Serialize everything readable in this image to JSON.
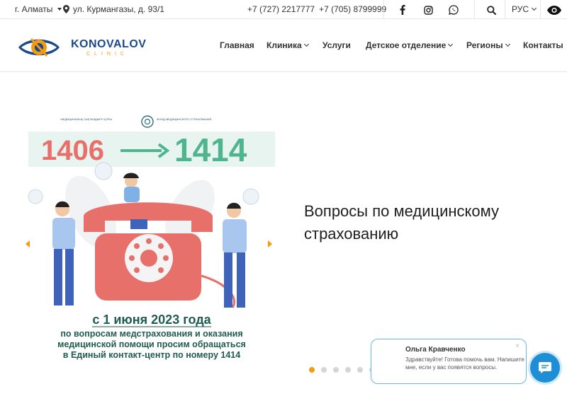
{
  "topbar": {
    "city": "г. Алматы",
    "address": "ул. Курмангазы, д. 93/1",
    "phone1": "+7 (727) 2217777",
    "phone2": "+7 (705) 8799999",
    "lang": "РУС"
  },
  "logo": {
    "name": "KONOVALOV",
    "sub": "CLINIC"
  },
  "nav": {
    "items": [
      {
        "label": "Главная"
      },
      {
        "label": "Клиника"
      },
      {
        "label": "Услуги"
      },
      {
        "label": "Детское отделение"
      },
      {
        "label": "Регионы"
      },
      {
        "label": "Контакты"
      }
    ]
  },
  "slide": {
    "title": "Вопросы по медицинскому страхованию",
    "poster": {
      "old_number": "1406",
      "new_number": "1414",
      "org_left": "МЕДИЦИНАЛЫҚ САҚТАНДЫРУ ҚОРЫ",
      "org_right": "ФОНД МЕДИЦИНСКОГО СТРАХОВАНИЯ",
      "date": "с 1 июня 2023 года",
      "line1": "по вопросам медстрахования и оказания",
      "line2": "медицинской помощи просим обращаться",
      "line3": "в Единый контакт-центр по номеру 1414"
    },
    "active_dot": 1,
    "dots_count": 6
  },
  "chat": {
    "name": "Ольга Кравченко",
    "message": "Здравствуйте! Готова помочь вам. Напишите мне, если у вас появятся вопросы.",
    "close": "×"
  },
  "colors": {
    "accent": "#f39c12",
    "brand": "#1b4a8c",
    "poster_red": "#e8706a",
    "poster_green": "#4fb58e",
    "chat_blue": "#1e8fd6"
  }
}
